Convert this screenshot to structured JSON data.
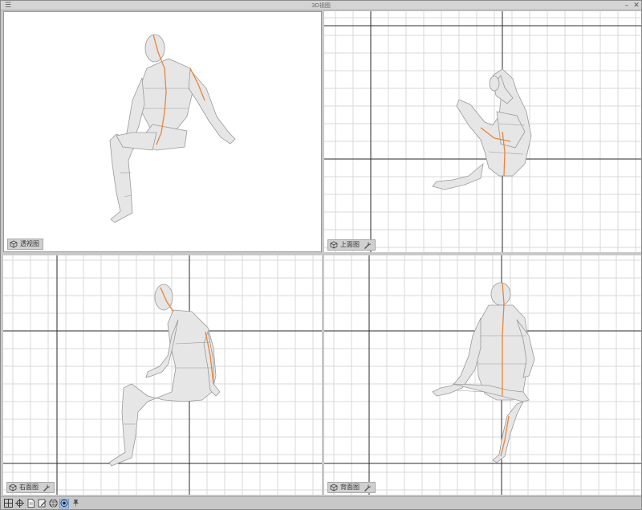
{
  "window": {
    "title": "3D视图",
    "menu_icon": "hamburger-icon",
    "minimize_icon": "minimize-icon",
    "close_icon": "close-icon"
  },
  "viewports": {
    "perspective": {
      "label": "透视图",
      "icon": "cube-icon"
    },
    "top": {
      "label": "上面图",
      "icon": "cube-icon",
      "tool_icon": "wrench-icon"
    },
    "right": {
      "label": "右面图",
      "icon": "cube-icon",
      "tool_icon": "wrench-icon"
    },
    "back": {
      "label": "背面图",
      "icon": "cube-icon",
      "tool_icon": "wrench-icon"
    }
  },
  "statusbar": {
    "icons": [
      "layout-grid-icon",
      "crosshair-icon",
      "document-icon",
      "edit-icon",
      "sphere-icon",
      "camera-orbit-icon",
      "pin-icon"
    ],
    "active_index": 5
  },
  "colors": {
    "grid_minor": "#d8d8d8",
    "grid_major": "#2a2a2a",
    "figure_fill": "#e6e6e6",
    "figure_line": "#9a9a9a",
    "figure_accent": "#e8863a"
  }
}
